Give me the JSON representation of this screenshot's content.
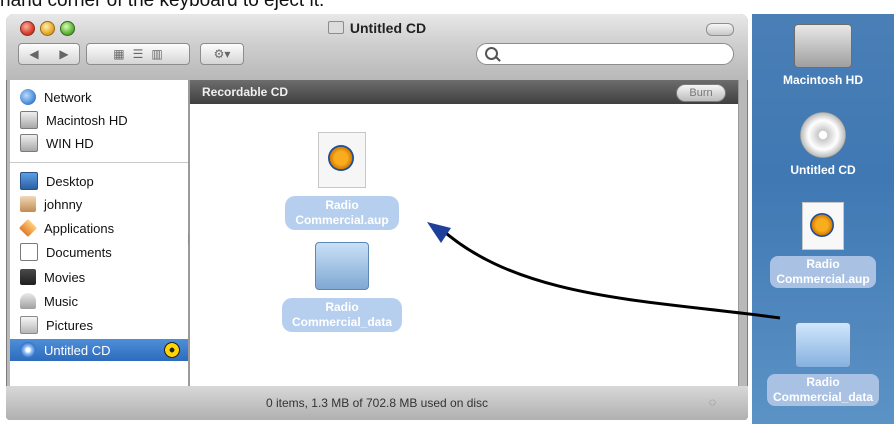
{
  "caption": {
    "text": "hand corner of the keyboard to eject it."
  },
  "window": {
    "title": "Untitled CD",
    "toolbar": {
      "back_icon": "back-arrow",
      "forward_icon": "forward-arrow",
      "action_icon": "gear-icon",
      "search_placeholder": ""
    }
  },
  "sidebar": {
    "items": [
      {
        "label": "Network",
        "icon": "network-icon"
      },
      {
        "label": "Macintosh HD",
        "icon": "hard-drive-icon"
      },
      {
        "label": "WIN HD",
        "icon": "hard-drive-icon"
      },
      {
        "label": "Desktop",
        "icon": "desktop-icon"
      },
      {
        "label": "johnny",
        "icon": "home-icon"
      },
      {
        "label": "Applications",
        "icon": "applications-icon"
      },
      {
        "label": "Documents",
        "icon": "documents-icon"
      },
      {
        "label": "Movies",
        "icon": "movies-icon"
      },
      {
        "label": "Music",
        "icon": "music-icon"
      },
      {
        "label": "Pictures",
        "icon": "pictures-icon"
      },
      {
        "label": "Untitled CD",
        "icon": "cd-icon"
      }
    ]
  },
  "content": {
    "header": "Recordable CD",
    "burn_label": "Burn",
    "files": [
      {
        "line1": "Radio",
        "line2": "Commercial.aup",
        "icon": "audacity-document-icon"
      },
      {
        "line1": "Radio",
        "line2": "Commercial_data",
        "icon": "folder-icon"
      }
    ]
  },
  "status": {
    "text": "0 items, 1.3 MB of 702.8 MB used on disc"
  },
  "desktop": {
    "items": [
      {
        "line1": "Macintosh HD",
        "line2": "",
        "icon": "hard-drive-icon"
      },
      {
        "line1": "Untitled CD",
        "line2": "",
        "icon": "cd-icon"
      },
      {
        "line1": "Radio",
        "line2": "Commercial.aup",
        "icon": "audacity-document-icon"
      },
      {
        "line1": "Radio",
        "line2": "Commercial_data",
        "icon": "folder-icon"
      }
    ]
  },
  "colors": {
    "accent_selected": "#2d6bbd",
    "desktop_bg": "#4a7fb6",
    "arrow": "#000000",
    "arrow_head": "#1f3f9c"
  }
}
